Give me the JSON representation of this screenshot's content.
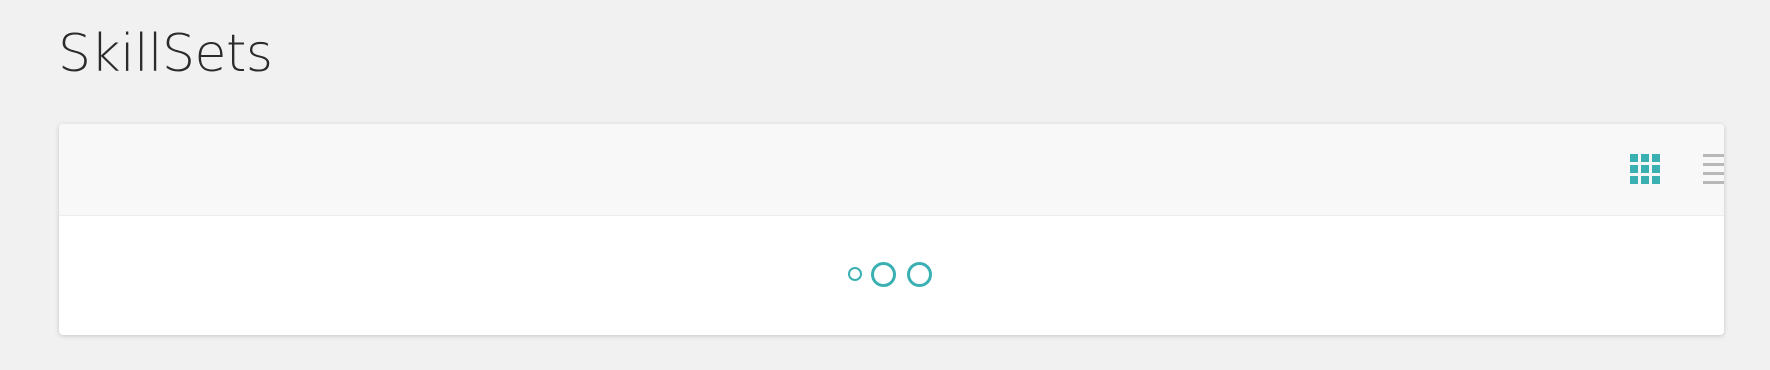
{
  "page": {
    "title": "SkillSets"
  },
  "toolbar": {
    "views": [
      {
        "name": "grid",
        "icon": "grid-view-icon",
        "active": true
      },
      {
        "name": "list",
        "icon": "list-view-icon",
        "active": false
      }
    ]
  },
  "content": {
    "state": "loading",
    "loader_icon": "loading-dots-icon"
  },
  "colors": {
    "accent": "#3ab0b3",
    "inactive_icon": "#b8b8b8",
    "page_background": "#f1f1f1",
    "toolbar_background": "#f8f8f8",
    "title_text": "#2b2b2b"
  }
}
